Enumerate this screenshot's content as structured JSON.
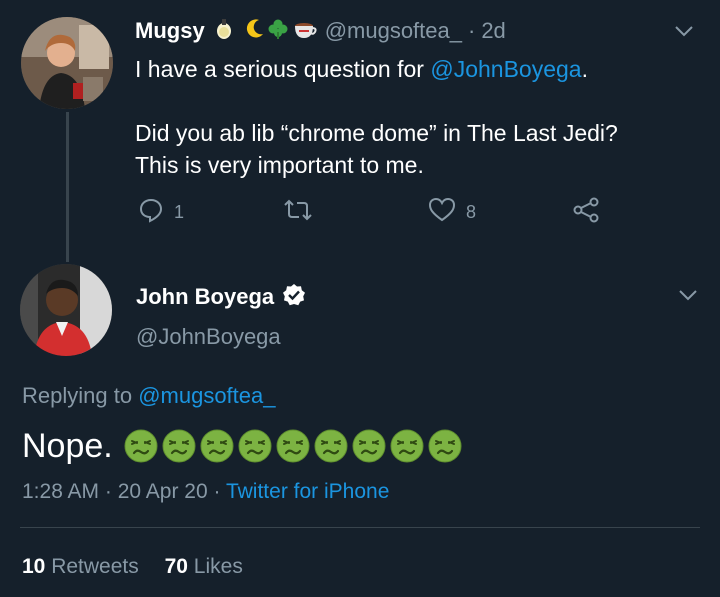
{
  "tweet1": {
    "display_name": "Mugsy",
    "name_emojis": [
      "lemon-icon",
      "crescent-moon-icon",
      "shamrock-icon",
      "tea-cup-icon"
    ],
    "handle": "@mugsoftea_",
    "separator": "·",
    "time_ago": "2d",
    "line1_prefix": "I have a serious question for ",
    "line1_mention": "@JohnBoyega",
    "line1_suffix": ".",
    "line2": "Did you ab lib “chrome dome” in The Last Jedi?",
    "line3": "This is very important to me.",
    "reply_count": "1",
    "retweet_count": "",
    "like_count": "8"
  },
  "tweet2": {
    "display_name": "John Boyega",
    "verified": true,
    "handle": "@JohnBoyega",
    "replying_prefix": "Replying to ",
    "replying_handle": "@mugsoftea_",
    "text": "Nope.",
    "emoji_name": "nauseated-face-icon",
    "emoji_count": 9,
    "time": "1:28 AM",
    "sep": "·",
    "date": "20 Apr 20",
    "source": "Twitter for iPhone",
    "retweets": "10",
    "retweets_label": "Retweets",
    "likes": "70",
    "likes_label": "Likes"
  },
  "colors": {
    "background": "#15202b",
    "accent": "#1b95e0",
    "muted": "#8899a6",
    "divider": "#38444d",
    "emoji_green": "#7cb342"
  }
}
